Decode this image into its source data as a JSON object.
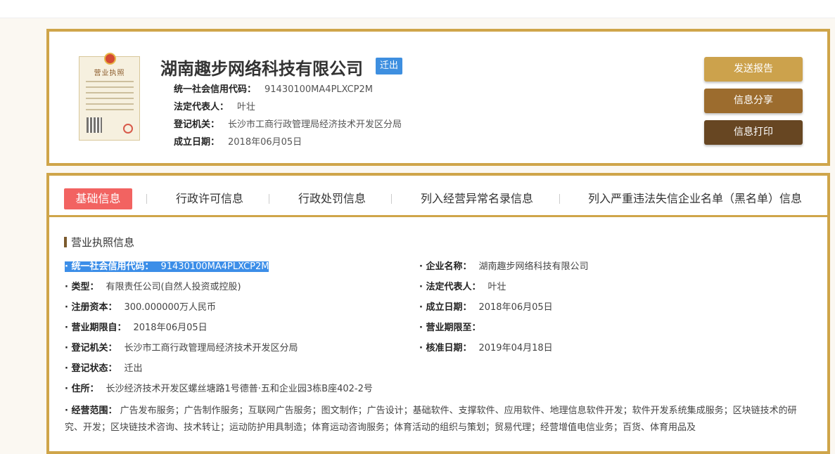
{
  "company": {
    "name": "湖南趣步网络科技有限公司",
    "status_badge": "迁出",
    "license_title": "营业执照"
  },
  "summary": [
    {
      "label": "统一社会信用代码：",
      "value": "91430100MA4PLXCP2M"
    },
    {
      "label": "法定代表人：",
      "value": "叶壮"
    },
    {
      "label": "登记机关：",
      "value": "长沙市工商行政管理局经济技术开发区分局"
    },
    {
      "label": "成立日期：",
      "value": "2018年06月05日"
    }
  ],
  "actions": {
    "send_report": "发送报告",
    "share": "信息分享",
    "print": "信息打印"
  },
  "tabs": [
    "基础信息",
    "行政许可信息",
    "行政处罚信息",
    "列入经营异常名录信息",
    "列入严重违法失信企业名单（黑名单）信息"
  ],
  "section_title": "营业执照信息",
  "fields": {
    "credit_code": {
      "label": "统一社会信用代码：",
      "value": "91430100MA4PLXCP2M"
    },
    "company_name": {
      "label": "企业名称：",
      "value": "湖南趣步网络科技有限公司"
    },
    "type": {
      "label": "类型：",
      "value": "有限责任公司(自然人投资或控股)"
    },
    "legal_rep": {
      "label": "法定代表人：",
      "value": "叶壮"
    },
    "capital": {
      "label": "注册资本：",
      "value": "300.000000万人民币"
    },
    "founded": {
      "label": "成立日期：",
      "value": "2018年06月05日"
    },
    "term_from": {
      "label": "营业期限自：",
      "value": "2018年06月05日"
    },
    "term_to": {
      "label": "营业期限至：",
      "value": ""
    },
    "authority": {
      "label": "登记机关：",
      "value": "长沙市工商行政管理局经济技术开发区分局"
    },
    "approval_date": {
      "label": "核准日期：",
      "value": "2019年04月18日"
    },
    "reg_status": {
      "label": "登记状态：",
      "value": "迁出"
    },
    "address": {
      "label": "住所：",
      "value": "长沙经济技术开发区螺丝塘路1号德普·五和企业园3栋B座402-2号"
    }
  },
  "scope": {
    "label": "经营范围：",
    "value": "广告发布服务；广告制作服务；互联网广告服务；图文制作；广告设计；基础软件、支撑软件、应用软件、地理信息软件开发；软件开发系统集成服务；区块链技术的研究、开发；区块链技术咨询、技术转让；运动防护用具制造；体育运动咨询服务；体育活动的组织与策划；贸易代理；经营增值电信业务；百货、体育用品及"
  }
}
